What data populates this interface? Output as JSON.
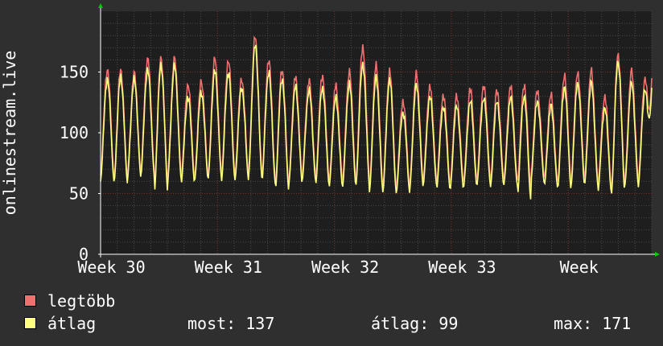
{
  "ylabel": "onlinestream.live",
  "legend": {
    "max_label": "legtöbb",
    "avg_label": "átlag"
  },
  "stats": {
    "now_label": "most:",
    "now_value": "137",
    "avg_label": "átlag:",
    "avg_value": "99",
    "max_label": "max:",
    "max_value": "171"
  },
  "colors": {
    "background": "#2f2f2f",
    "plot_background": "#1e1e1e",
    "grid": "#4a4a4a",
    "week_grid": "#7a2e2e",
    "axis_text": "#ffffff",
    "max_series": "#f07070",
    "avg_series": "#ffff80",
    "arrow": "#00cc00"
  },
  "chart_data": {
    "type": "line",
    "title": "",
    "xlabel": "",
    "ylabel": "onlinestream.live",
    "ylim": [
      0,
      200
    ],
    "yticks": [
      0,
      50,
      100,
      150
    ],
    "x_unit": "days",
    "xlim": [
      0,
      33
    ],
    "x_ticks": [
      {
        "x": 0.65,
        "label": "Week 30"
      },
      {
        "x": 7.65,
        "label": "Week 31"
      },
      {
        "x": 14.65,
        "label": "Week 32"
      },
      {
        "x": 21.65,
        "label": "Week 33"
      },
      {
        "x": 28.65,
        "label": "Week"
      }
    ],
    "grid": true,
    "legend_position": "bottom-left",
    "series": [
      {
        "name": "legtöbb",
        "daily_peaks": [
          153,
          152,
          148,
          162,
          162,
          160,
          140,
          143,
          160,
          160,
          145,
          178,
          160,
          153,
          145,
          143,
          148,
          138,
          150,
          172,
          155,
          150,
          127,
          148,
          137,
          132,
          130,
          135,
          140,
          135,
          137,
          140,
          135,
          130,
          148,
          150,
          150,
          130,
          165,
          150,
          145
        ],
        "daily_troughs": [
          65,
          62,
          68,
          70,
          55,
          68,
          62,
          65,
          66,
          65,
          66,
          68,
          62,
          56,
          62,
          66,
          62,
          60,
          60,
          62,
          56,
          55,
          55,
          60,
          62,
          58,
          58,
          60,
          62,
          60,
          62,
          55,
          64,
          60,
          58,
          62,
          62,
          56,
          54,
          62,
          60
        ],
        "final_value": 145
      },
      {
        "name": "átlag",
        "daily_peaks": [
          145,
          146,
          143,
          153,
          156,
          154,
          130,
          134,
          150,
          150,
          138,
          171,
          150,
          145,
          137,
          135,
          138,
          128,
          140,
          158,
          145,
          143,
          118,
          139,
          129,
          123,
          122,
          125,
          130,
          126,
          128,
          131,
          126,
          121,
          138,
          141,
          140,
          121,
          159,
          140,
          136
        ],
        "daily_troughs": [
          60,
          58,
          63,
          65,
          50,
          62,
          58,
          61,
          62,
          60,
          61,
          63,
          58,
          52,
          58,
          61,
          57,
          55,
          55,
          57,
          51,
          50,
          50,
          55,
          57,
          53,
          53,
          55,
          57,
          55,
          57,
          45,
          59,
          55,
          53,
          57,
          57,
          51,
          49,
          57,
          55
        ],
        "final_value": 137
      }
    ]
  }
}
